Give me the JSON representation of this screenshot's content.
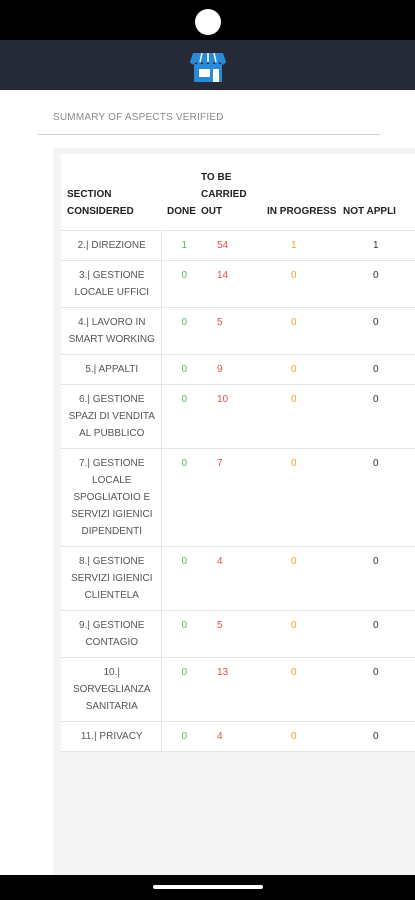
{
  "app": {
    "icon": "store-icon"
  },
  "summary_title": "SUMMARY OF ASPECTS VERIFIED",
  "columns": {
    "section": "SECTION CONSIDERED",
    "done": "DONE",
    "todo": "TO BE CARRIED OUT",
    "progress": "IN PROGRESS",
    "na": "NOT APPLI"
  },
  "rows": [
    {
      "section": "2.| DIREZIONE",
      "done": "1",
      "todo": "54",
      "progress": "1",
      "na": "1"
    },
    {
      "section": "3.| GESTIONE LOCALE UFFICI",
      "done": "0",
      "todo": "14",
      "progress": "0",
      "na": "0"
    },
    {
      "section": "4.| LAVORO IN SMART WORKING",
      "done": "0",
      "todo": "5",
      "progress": "0",
      "na": "0"
    },
    {
      "section": "5.| APPALTI",
      "done": "0",
      "todo": "9",
      "progress": "0",
      "na": "0"
    },
    {
      "section": "6.| GESTIONE SPAZI DI VENDITA AL PUBBLICO",
      "done": "0",
      "todo": "10",
      "progress": "0",
      "na": "0"
    },
    {
      "section": "7.| GESTIONE LOCALE SPOGLIATOIO E SERVIZI IGIENICI DIPENDENTI",
      "done": "0",
      "todo": "7",
      "progress": "0",
      "na": "0"
    },
    {
      "section": "8.| GESTIONE SERVIZI IGIENICI CLIENTELA",
      "done": "0",
      "todo": "4",
      "progress": "0",
      "na": "0"
    },
    {
      "section": "9.| GESTIONE CONTAGIO",
      "done": "0",
      "todo": "5",
      "progress": "0",
      "na": "0"
    },
    {
      "section": "10.| SORVEGLIANZA SANITARIA",
      "done": "0",
      "todo": "13",
      "progress": "0",
      "na": "0"
    },
    {
      "section": "11.| PRIVACY",
      "done": "0",
      "todo": "4",
      "progress": "0",
      "na": "0"
    }
  ],
  "colors": {
    "done": "#5cb85c",
    "todo": "#e05050",
    "progress": "#f0a030",
    "appbar": "#262a36",
    "icon": "#2a8ad8"
  }
}
